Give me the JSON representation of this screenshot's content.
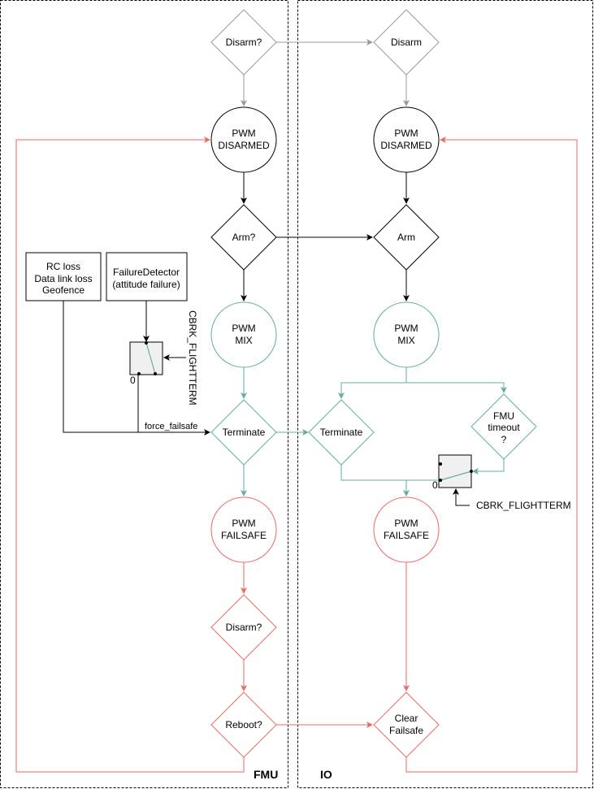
{
  "colors": {
    "gray": "#999999",
    "black": "#000000",
    "teal": "#67AB9F",
    "red": "#EA6B66",
    "switch_fill": "#F0F0F0"
  },
  "lanes": {
    "fmu": "FMU",
    "io": "IO"
  },
  "fmu": {
    "disarm_q": "Disarm?",
    "pwm_disarmed": [
      "PWM",
      "DISARMED"
    ],
    "arm_q": "Arm?",
    "pwm_mix": [
      "PWM",
      "MIX"
    ],
    "terminate": "Terminate",
    "pwm_failsafe": [
      "PWM",
      "FAILSAFE"
    ],
    "disarm_q2": "Disarm?",
    "reboot_q": "Reboot?",
    "rc_box": [
      "RC loss",
      "Data link loss",
      "Geofence"
    ],
    "fd_box": [
      "FailureDetector",
      "(attitude failure)"
    ],
    "cbrk": "CBRK_FLIGHTTERM",
    "switch_zero": "0",
    "force_failsafe": "force_failsafe"
  },
  "io": {
    "disarm": "Disarm",
    "pwm_disarmed": [
      "PWM",
      "DISARMED"
    ],
    "arm": "Arm",
    "pwm_mix": [
      "PWM",
      "MIX"
    ],
    "terminate": "Terminate",
    "fmu_timeout": [
      "FMU",
      "timeout",
      "?"
    ],
    "pwm_failsafe": [
      "PWM",
      "FAILSAFE"
    ],
    "clear_failsafe": [
      "Clear",
      "Failsafe"
    ],
    "cbrk": "CBRK_FLIGHTTERM",
    "switch_zero": "0"
  }
}
